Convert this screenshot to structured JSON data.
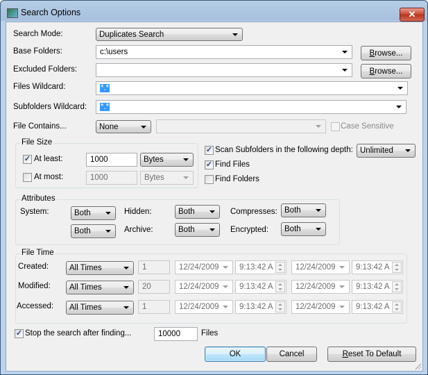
{
  "window": {
    "title": "Search Options",
    "icon": "app-icon",
    "close_icon": "close-icon"
  },
  "search_mode": {
    "label": "Search Mode:",
    "value": "Duplicates Search"
  },
  "base_folders": {
    "label": "Base Folders:",
    "value": "c:\\users",
    "browse_label_u": "B",
    "browse_label_rest": "rowse..."
  },
  "excluded_folders": {
    "label": "Excluded Folders:",
    "value": "",
    "browse_label_u": "B",
    "browse_label_rest": "rowse..."
  },
  "files_wildcard": {
    "label": "Files Wildcard:",
    "value": "*.*"
  },
  "subfolders_wildcard": {
    "label": "Subfolders Wildcard:",
    "value": "*.*"
  },
  "file_contains": {
    "label": "File Contains...",
    "mode": "None",
    "text": "",
    "case_sensitive_label": "Case Sensitive",
    "case_sensitive_checked": false
  },
  "file_size": {
    "legend": "File Size",
    "at_least": {
      "label": "At least:",
      "checked": true,
      "value": "1000",
      "unit": "Bytes"
    },
    "at_most": {
      "label": "At most:",
      "checked": false,
      "value": "1000",
      "unit": "Bytes"
    }
  },
  "scan_subfolders": {
    "label": "Scan Subfolders in the following depth:",
    "checked": true,
    "depth": "Unlimited"
  },
  "find_files": {
    "label": "Find Files",
    "checked": true
  },
  "find_folders": {
    "label": "Find Folders",
    "checked": false
  },
  "attributes": {
    "legend": "Attributes",
    "system_label": "System:",
    "system_value": "Both",
    "system_value2": "Both",
    "hidden_label": "Hidden:",
    "hidden_value": "Both",
    "archive_label": "Archive:",
    "archive_value": "Both",
    "compresses_label": "Compresses:",
    "compresses_value": "Both",
    "encrypted_label": "Encrypted:",
    "encrypted_value": "Both"
  },
  "file_time": {
    "legend": "File Time",
    "rows": [
      {
        "label": "Created:",
        "mode": "All Times",
        "count": "1",
        "date1": "12/24/2009",
        "time1": "9:13:42 A",
        "date2": "12/24/2009",
        "time2": "9:13:42 A"
      },
      {
        "label": "Modified:",
        "mode": "All Times",
        "count": "20",
        "date1": "12/24/2009",
        "time1": "9:13:42 A",
        "date2": "12/24/2009",
        "time2": "9:13:42 A"
      },
      {
        "label": "Accessed:",
        "mode": "All Times",
        "count": "1",
        "date1": "12/24/2009",
        "time1": "9:13:42 A",
        "date2": "12/24/2009",
        "time2": "9:13:42 A"
      }
    ]
  },
  "stop_search": {
    "label": "Stop the search after finding...",
    "checked": true,
    "value": "10000",
    "unit": "Files"
  },
  "buttons": {
    "ok": "OK",
    "cancel": "Cancel",
    "reset_u": "R",
    "reset_rest": "eset To Default"
  },
  "check_glyph": "✓"
}
